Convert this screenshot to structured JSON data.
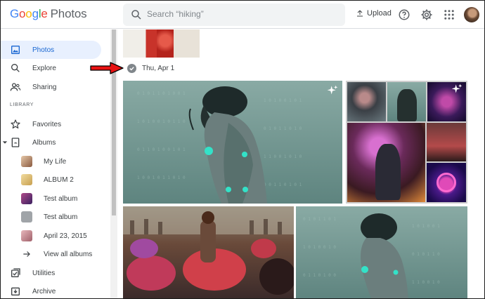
{
  "app": {
    "logo_letters": [
      "G",
      "o",
      "o",
      "g",
      "l",
      "e"
    ],
    "logo_product": "Photos"
  },
  "header": {
    "search_placeholder": "Search “hiking”",
    "upload_label": "Upload",
    "icons": [
      "search-icon",
      "upload-icon",
      "help-icon",
      "settings-icon",
      "apps-grid-icon",
      "account-avatar"
    ]
  },
  "sidebar": {
    "items": [
      {
        "label": "Photos",
        "icon": "photos-icon",
        "active": true
      },
      {
        "label": "Explore",
        "icon": "search-icon"
      },
      {
        "label": "Sharing",
        "icon": "people-icon"
      }
    ],
    "library_heading": "LIBRARY",
    "library_items": [
      {
        "label": "Favorites",
        "icon": "star-icon"
      },
      {
        "label": "Albums",
        "icon": "album-icon",
        "expanded": true
      }
    ],
    "albums": [
      {
        "label": "My Life",
        "color": "#c8a07a"
      },
      {
        "label": "ALBUM 2",
        "color": "#e0c27a"
      },
      {
        "label": "Test album",
        "color": "#7a3a8a"
      },
      {
        "label": "Test album",
        "color": "#9aa0a6"
      },
      {
        "label": "April 23, 2015",
        "color": "#c9959c"
      }
    ],
    "view_all": "View all albums",
    "bottom_items": [
      {
        "label": "Utilities",
        "icon": "utilities-icon"
      },
      {
        "label": "Archive",
        "icon": "archive-icon"
      }
    ]
  },
  "main": {
    "date_label": "Thu, Apr 1",
    "photos": [
      {
        "name": "cyber-girl-matrix-large",
        "color": "#6f9690"
      },
      {
        "name": "cyber-gunner-girl-small",
        "color": "#3c4a4a"
      },
      {
        "name": "cyber-girl-matrix-small",
        "color": "#6f9690"
      },
      {
        "name": "pink-neon-girl-small",
        "color": "#5a2a66"
      },
      {
        "name": "cyber-purple-hair-gunner",
        "color": "#5a3a4a"
      },
      {
        "name": "cyber-motorbike-rider-small",
        "color": "#5a3a3a"
      },
      {
        "name": "neon-ring-portal",
        "color": "#2a1a5a"
      },
      {
        "name": "motorbike-race-crowd",
        "color": "#6a4a3a"
      },
      {
        "name": "cyber-girl-matrix-large-2",
        "color": "#6f9690"
      }
    ]
  }
}
